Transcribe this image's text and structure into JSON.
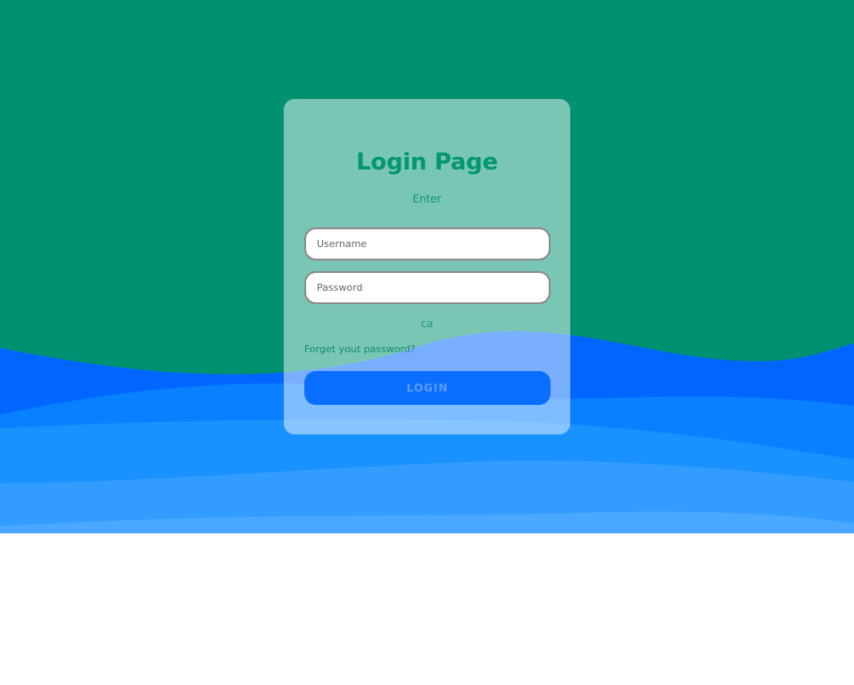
{
  "colors": {
    "background_top": "#009270",
    "wave_dark": "#0066ff",
    "wave_mid": "#1a8cff",
    "wave_light": "#3aa0ff",
    "accent_text": "#039672",
    "button": "#0a6fff"
  },
  "login_card": {
    "title": "Login Page",
    "subtitle": "Enter",
    "username_placeholder": "Username",
    "password_placeholder": "Password",
    "status_text": "ca",
    "forgot_link": "Forget yout password?",
    "login_button": "LOGIN"
  }
}
